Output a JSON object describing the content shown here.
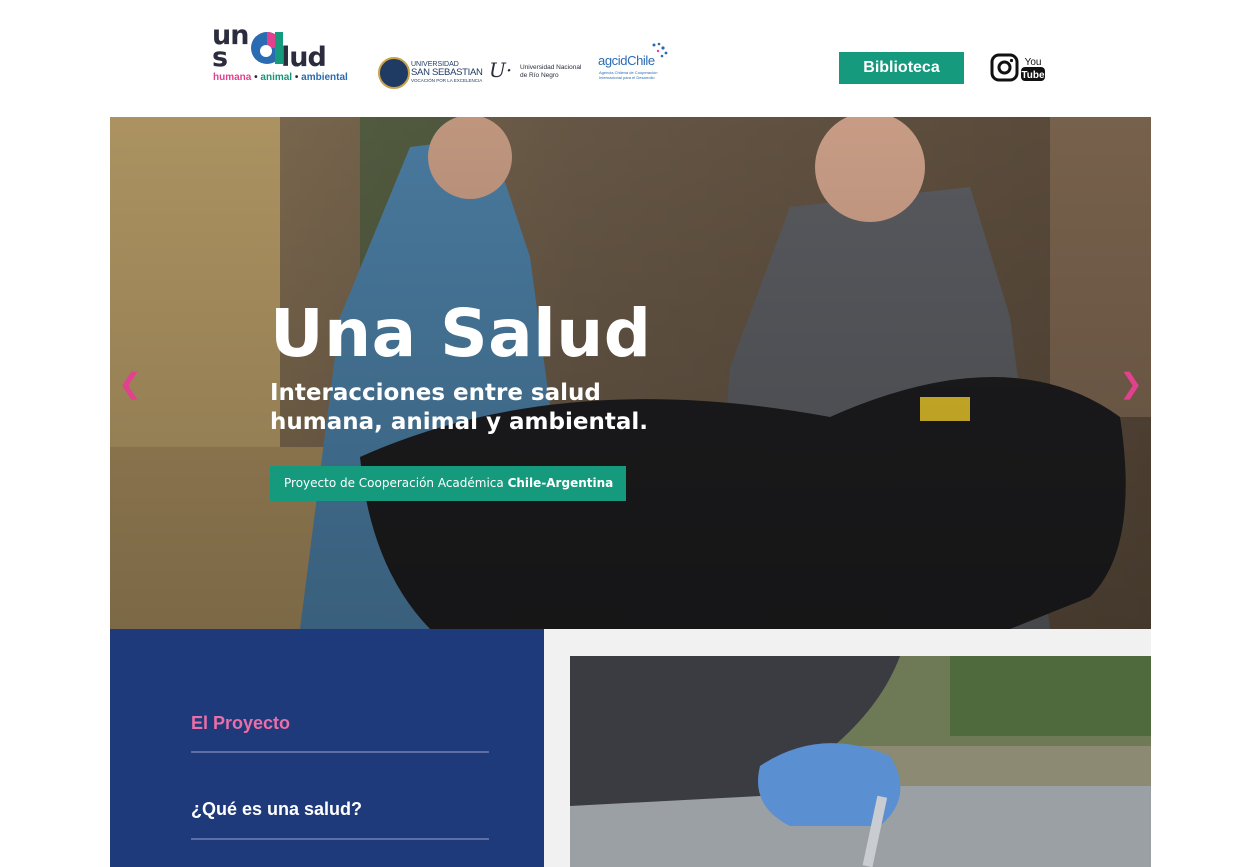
{
  "header": {
    "logo": {
      "line1": "un",
      "line2_left": "s",
      "line2_right": "lud",
      "tagline_humana": "humana",
      "tagline_animal": "animal",
      "tagline_ambiental": "ambiental",
      "tagline_sep": " • "
    },
    "partners": {
      "uss_line1": "UNIVERSIDAD",
      "uss_line2": "SAN SEBASTIAN",
      "uss_line3": "VOCACIÓN POR LA EXCELENCIA",
      "unrn_mark": "U·",
      "unrn_line1": "Universidad Nacional",
      "unrn_line2": "de Río Negro",
      "agcid_name": "agcidChile",
      "agcid_sub": "Agencia Chilena de Cooperación Internacional para el Desarrollo"
    },
    "library_button": "Biblioteca",
    "colors": {
      "pink": "#e2418d",
      "green": "#159a7e",
      "navy": "#1f3a7a",
      "dark": "#2b2d3f",
      "blue": "#2b6bb2"
    }
  },
  "hero": {
    "title": "Una Salud",
    "subtitle": "Interacciones entre salud humana, animal y ambiental.",
    "badge_prefix": "Proyecto de Cooperación Académica ",
    "badge_bold": "Chile-Argentina",
    "prev_glyph": "❮",
    "next_glyph": "❯"
  },
  "sidebar": {
    "items": [
      {
        "label": "El Proyecto"
      },
      {
        "label": "¿Qué es una salud?"
      }
    ]
  }
}
